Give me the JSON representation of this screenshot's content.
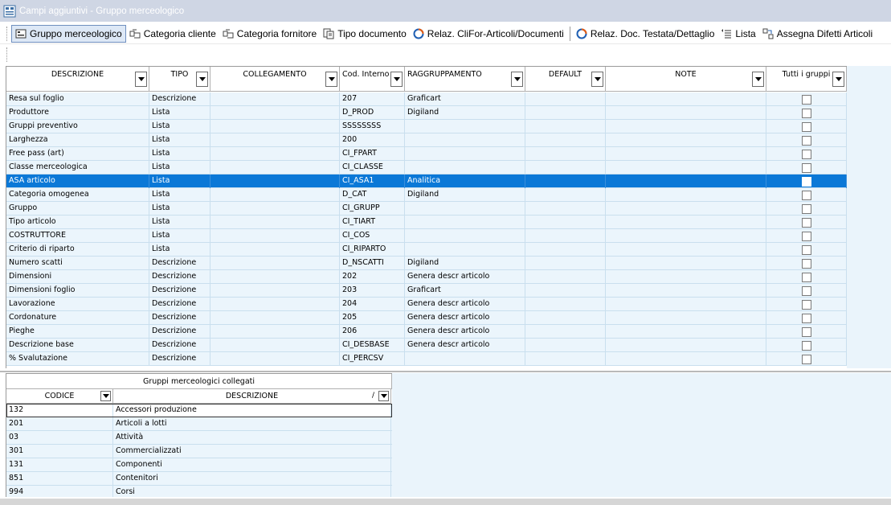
{
  "window": {
    "title": "Campi aggiuntivi - Gruppo merceologico"
  },
  "toolbar": {
    "items": [
      {
        "label": "Gruppo merceologico",
        "icon": "group-icon",
        "active": true
      },
      {
        "label": "Categoria cliente",
        "icon": "category-icon"
      },
      {
        "label": "Categoria fornitore",
        "icon": "category-icon"
      },
      {
        "label": "Tipo documento",
        "icon": "document-icon"
      },
      {
        "label": "Relaz. CliFor-Articoli/Documenti",
        "icon": "relation-icon"
      },
      {
        "label": "Relaz. Doc. Testata/Dettaglio",
        "icon": "relation-icon"
      },
      {
        "label": "Lista",
        "icon": "list-icon"
      },
      {
        "label": "Assegna Difetti Articoli",
        "icon": "assign-icon"
      }
    ]
  },
  "grid": {
    "columns": [
      "DESCRIZIONE",
      "TIPO",
      "COLLEGAMENTO",
      "Cod. Interno",
      "RAGGRUPPAMENTO",
      "DEFAULT",
      "NOTE",
      "Tutti i gruppi"
    ],
    "rows": [
      [
        "Resa sul foglio",
        "Descrizione",
        "",
        "207",
        "Graficart",
        "",
        ""
      ],
      [
        "Produttore",
        "Lista",
        "",
        "D_PROD",
        "Digiland",
        "",
        ""
      ],
      [
        "Gruppi preventivo",
        "Lista",
        "",
        "SSSSSSSS",
        "",
        "",
        ""
      ],
      [
        "Larghezza",
        "Lista",
        "",
        "200",
        "",
        "",
        ""
      ],
      [
        "Free pass (art)",
        "Lista",
        "",
        "CI_FPART",
        "",
        "",
        ""
      ],
      [
        "Classe merceologica",
        "Lista",
        "",
        "CI_CLASSE",
        "",
        "",
        ""
      ],
      [
        "ASA articolo",
        "Lista",
        "",
        "CI_ASA1",
        "Analitica",
        "",
        ""
      ],
      [
        "Categoria omogenea",
        "Lista",
        "",
        "D_CAT",
        "Digiland",
        "",
        ""
      ],
      [
        "Gruppo",
        "Lista",
        "",
        "CI_GRUPP",
        "",
        "",
        ""
      ],
      [
        "Tipo articolo",
        "Lista",
        "",
        "CI_TIART",
        "",
        "",
        ""
      ],
      [
        "COSTRUTTORE",
        "Lista",
        "",
        "CI_COS",
        "",
        "",
        ""
      ],
      [
        "Criterio di riparto",
        "Lista",
        "",
        "CI_RIPARTO",
        "",
        "",
        ""
      ],
      [
        "Numero scatti",
        "Descrizione",
        "",
        "D_NSCATTI",
        "Digiland",
        "",
        ""
      ],
      [
        "Dimensioni",
        "Descrizione",
        "",
        "202",
        "Genera descr articolo",
        "",
        ""
      ],
      [
        "Dimensioni foglio",
        "Descrizione",
        "",
        "203",
        "Graficart",
        "",
        ""
      ],
      [
        "Lavorazione",
        "Descrizione",
        "",
        "204",
        "Genera descr articolo",
        "",
        ""
      ],
      [
        "Cordonature",
        "Descrizione",
        "",
        "205",
        "Genera descr articolo",
        "",
        ""
      ],
      [
        "Pieghe",
        "Descrizione",
        "",
        "206",
        "Genera descr articolo",
        "",
        ""
      ],
      [
        "Descrizione base",
        "Descrizione",
        "",
        "CI_DESBASE",
        "Genera descr articolo",
        "",
        ""
      ],
      [
        "% Svalutazione",
        "Descrizione",
        "",
        "CI_PERCSV",
        "",
        "",
        ""
      ]
    ],
    "selected_row": 6
  },
  "linked_groups": {
    "title": "Gruppi merceologici collegati",
    "columns": [
      "CODICE",
      "DESCRIZIONE"
    ],
    "sort_indicator": "/",
    "rows": [
      [
        "132",
        "Accessori produzione"
      ],
      [
        "201",
        "Articoli a lotti"
      ],
      [
        "03",
        "Attività"
      ],
      [
        "301",
        "Commercializzati"
      ],
      [
        "131",
        "Componenti"
      ],
      [
        "851",
        "Contenitori"
      ],
      [
        "994",
        "Corsi"
      ]
    ]
  }
}
